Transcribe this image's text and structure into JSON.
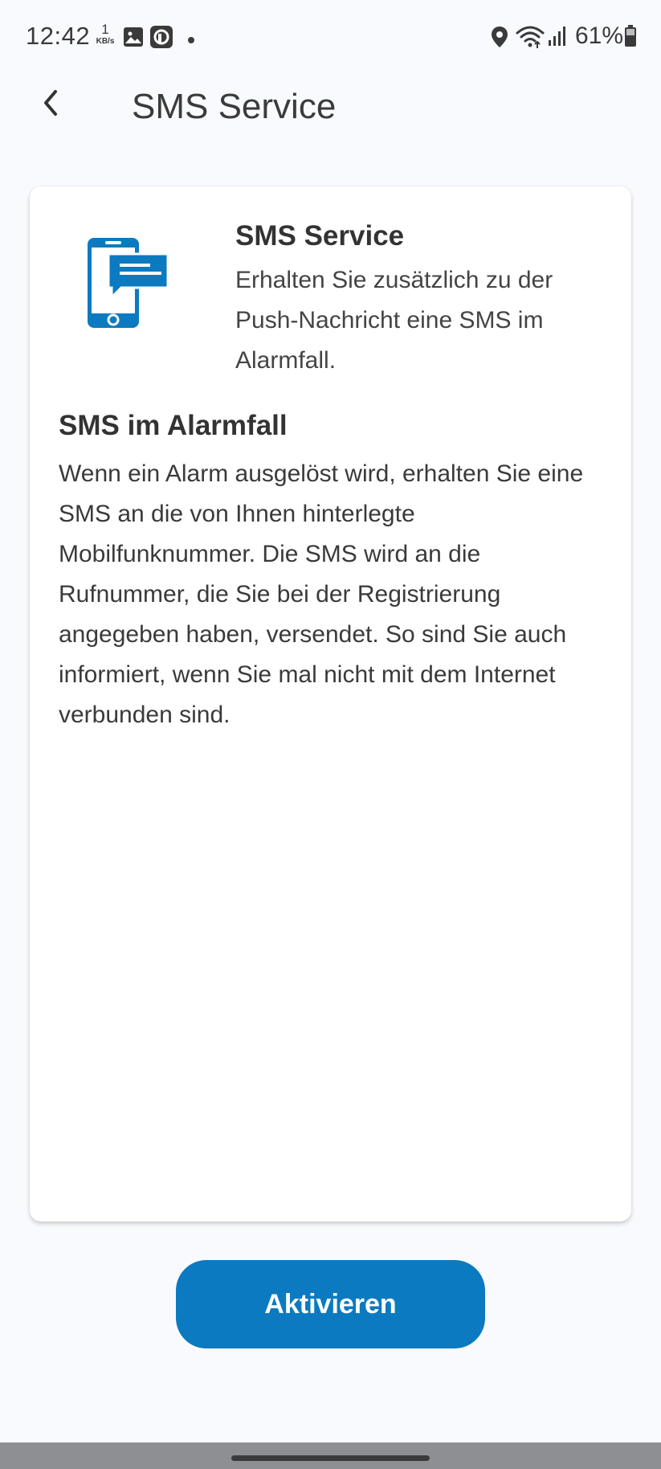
{
  "status_bar": {
    "time": "12:42",
    "speed_value": "1",
    "speed_unit": "KB/s",
    "battery": "61%",
    "icons": [
      "image-icon",
      "app-notification-icon",
      "dot-icon",
      "location-icon",
      "wifi-icon",
      "signal-icon",
      "battery-icon"
    ]
  },
  "app_bar": {
    "title": "SMS Service",
    "back_icon": "chevron-left-icon"
  },
  "card": {
    "icon": "phone-sms-icon",
    "title": "SMS Service",
    "subtitle": "Erhalten Sie zusätzlich zu der Push-Nachricht eine SMS im Alarmfall.",
    "section_title": "SMS im Alarmfall",
    "section_body": "Wenn ein Alarm ausgelöst wird, erhalten Sie eine SMS an die von Ihnen hinterlegte Mobilfunknummer. Die SMS wird an die Rufnummer, die Sie bei der Registrierung angegeben haben, versendet. So sind Sie auch informiert, wenn Sie mal nicht mit dem Internet verbunden sind."
  },
  "actions": {
    "activate_label": "Aktivieren"
  },
  "colors": {
    "accent": "#0b7ac0",
    "background": "#f9fafd",
    "card": "#ffffff"
  }
}
